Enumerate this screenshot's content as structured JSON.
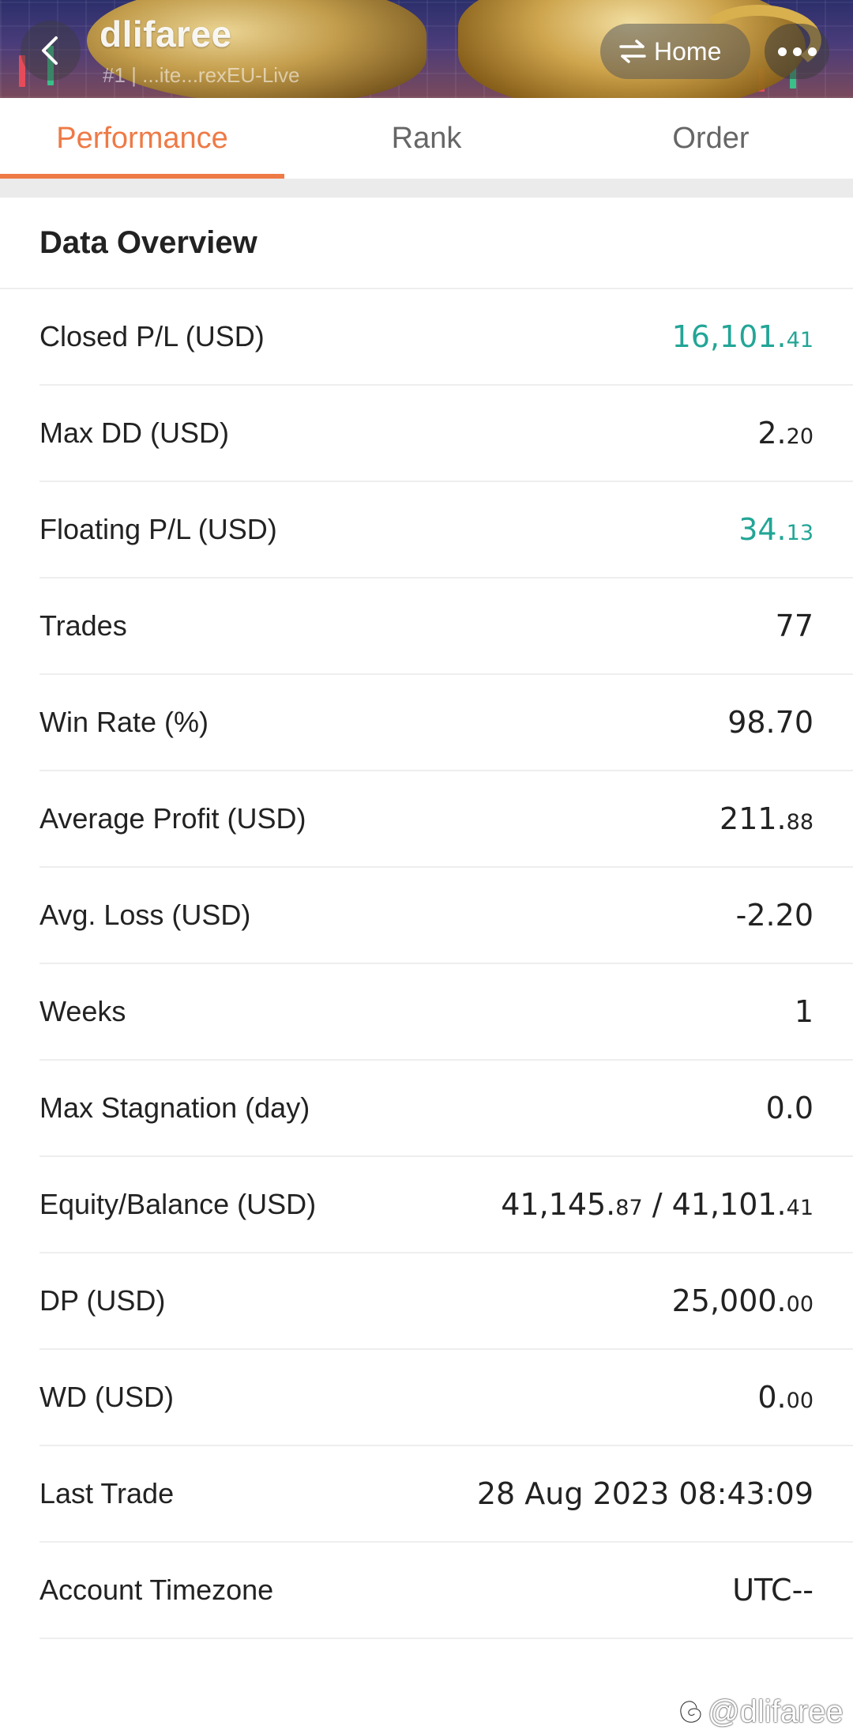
{
  "header": {
    "title": "dlifaree",
    "subtitle": "#1 | ...ite...rexEU-Live",
    "home_label": "Home"
  },
  "tabs": [
    {
      "label": "Performance",
      "active": true
    },
    {
      "label": "Rank",
      "active": false
    },
    {
      "label": "Order",
      "active": false
    }
  ],
  "section_title": "Data Overview",
  "rows": [
    {
      "label": "Closed P/L (USD)",
      "main": "16,101.",
      "dec": "41",
      "color": "green"
    },
    {
      "label": "Max DD (USD)",
      "main": "2.",
      "dec": "20",
      "color": "default"
    },
    {
      "label": "Floating P/L (USD)",
      "main": "34.",
      "dec": "13",
      "color": "green"
    },
    {
      "label": "Trades",
      "main": "77",
      "dec": "",
      "color": "default"
    },
    {
      "label": "Win Rate (%)",
      "main": "98.70",
      "dec": "",
      "color": "default"
    },
    {
      "label": "Average Profit (USD)",
      "main": "211.",
      "dec": "88",
      "color": "default"
    },
    {
      "label": "Avg. Loss (USD)",
      "main": "-2.20",
      "dec": "",
      "color": "default"
    },
    {
      "label": "Weeks",
      "main": "1",
      "dec": "",
      "color": "default"
    },
    {
      "label": "Max Stagnation (day)",
      "main": "0.0",
      "dec": "",
      "color": "default"
    },
    {
      "label": "Equity/Balance (USD)",
      "main": "41,145.",
      "dec": "87",
      "main2": " / 41,101.",
      "dec2": "41",
      "color": "default"
    },
    {
      "label": "DP (USD)",
      "main": "25,000.",
      "dec": "00",
      "color": "default"
    },
    {
      "label": "WD (USD)",
      "main": "0.",
      "dec": "00",
      "color": "default"
    },
    {
      "label": "Last Trade",
      "main": "28 Aug 2023 08:43:09",
      "dec": "",
      "color": "default"
    },
    {
      "label": "Account Timezone",
      "main": "UTC--",
      "dec": "",
      "color": "default"
    }
  ],
  "watermark": "@dlifaree",
  "colors": {
    "accent": "#ee7a46",
    "profit_green": "#23a596"
  },
  "icons": {
    "back": "chevron-left-icon",
    "home": "swap-arrows-icon",
    "more": "more-dots-icon",
    "watermark": "threads-icon"
  }
}
